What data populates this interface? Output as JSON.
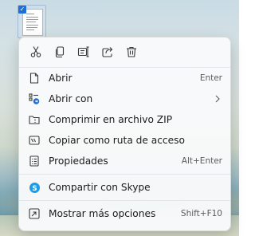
{
  "quick_actions": [
    {
      "name": "cut",
      "icon": "scissors-icon"
    },
    {
      "name": "copy",
      "icon": "copy-icon"
    },
    {
      "name": "rename",
      "icon": "rename-icon"
    },
    {
      "name": "share",
      "icon": "share-icon"
    },
    {
      "name": "delete",
      "icon": "trash-icon"
    }
  ],
  "menu": {
    "open": {
      "label": "Abrir",
      "shortcut": "Enter",
      "icon": "document-icon"
    },
    "open_with": {
      "label": "Abrir con",
      "icon": "open-with-icon"
    },
    "compress": {
      "label": "Comprimir en archivo ZIP",
      "icon": "zip-folder-icon"
    },
    "copy_path": {
      "label": "Copiar como ruta de acceso",
      "icon": "path-icon"
    },
    "properties": {
      "label": "Propiedades",
      "shortcut": "Alt+Enter",
      "icon": "properties-icon"
    },
    "skype": {
      "label": "Compartir con Skype",
      "icon": "skype-icon"
    },
    "more": {
      "label": "Mostrar más opciones",
      "shortcut": "Shift+F10",
      "icon": "more-options-icon"
    }
  },
  "colors": {
    "accent": "#1f6fd6",
    "skype": "#1e9be8",
    "menu_bg": "#f9fafb",
    "text": "#1b1b1b"
  }
}
